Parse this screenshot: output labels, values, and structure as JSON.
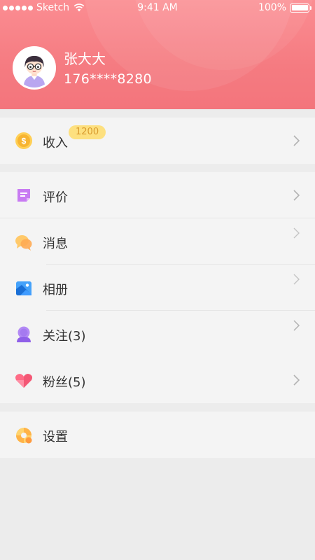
{
  "status_bar": {
    "carrier": "Sketch",
    "time": "9:41 AM",
    "battery": "100%"
  },
  "profile": {
    "name": "张大大",
    "phone": "176****8280"
  },
  "menu": {
    "income": {
      "label": "收入",
      "badge": "1200",
      "icon": "coin-icon"
    },
    "review": {
      "label": "评价",
      "icon": "note-icon"
    },
    "messages": {
      "label": "消息",
      "icon": "chat-bubbles-icon"
    },
    "album": {
      "label": "相册",
      "icon": "photo-icon"
    },
    "following": {
      "label": "关注(3)",
      "icon": "person-icon"
    },
    "fans": {
      "label": "粉丝(5)",
      "icon": "heart-icon"
    },
    "settings": {
      "label": "设置",
      "icon": "gear-icon"
    }
  },
  "colors": {
    "header": "#f57b81",
    "badge_bg": "#fde07f",
    "badge_text": "#d99b2f"
  }
}
